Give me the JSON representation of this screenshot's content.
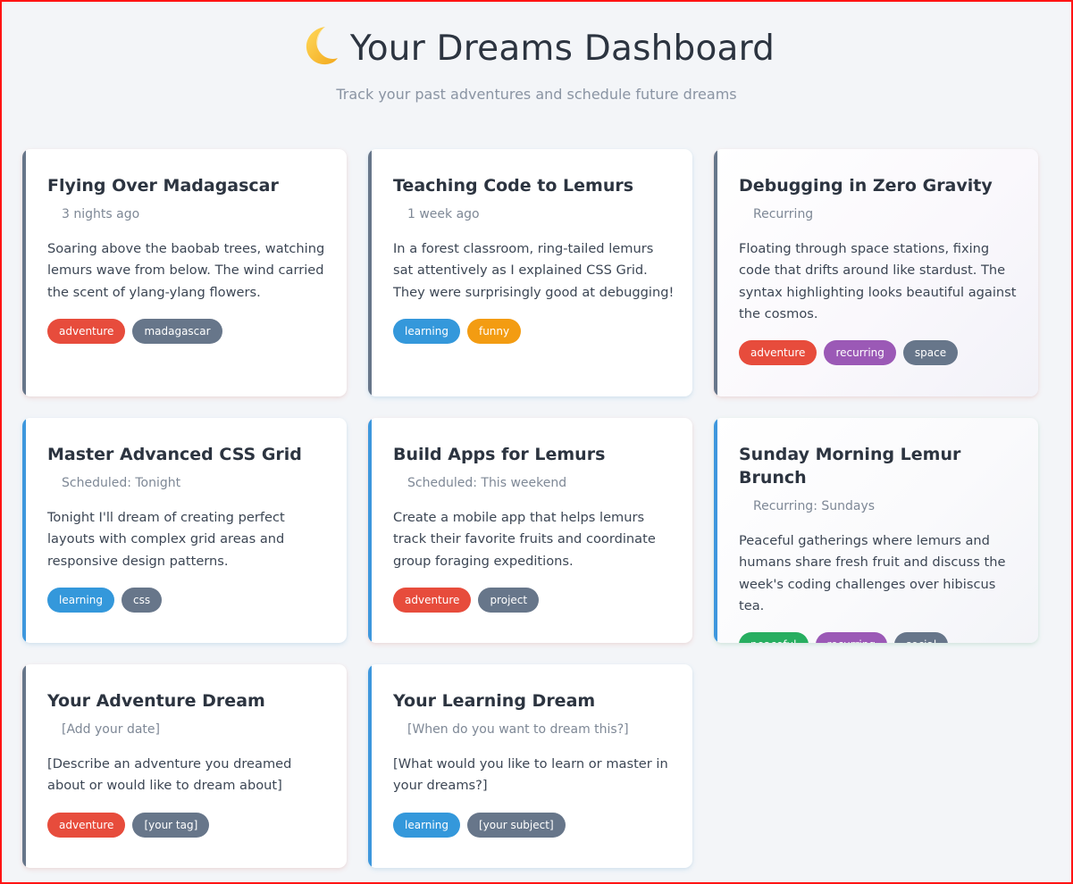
{
  "header": {
    "title": "Your Dreams Dashboard",
    "subtitle": "Track your past adventures and schedule future dreams",
    "moon_icon": "crescent-moon-icon"
  },
  "colors": {
    "page_bg": "#f3f5f8",
    "past_accent": "#67768a",
    "future_accent": "#3d97dd",
    "tag_adventure": "#e74c3c",
    "tag_learning": "#3498db",
    "tag_funny": "#f39c12",
    "tag_recurring": "#9b59b6",
    "tag_peaceful": "#27ae60",
    "tag_neutral": "#67768a"
  },
  "cards": [
    {
      "title": "Flying Over Madagascar",
      "date": "3 nights ago",
      "description": "Soaring above the baobab trees, watching lemurs wave from below. The wind carried the scent of ylang-ylang flowers.",
      "tags": [
        {
          "label": "adventure",
          "color": "#e74c3c"
        },
        {
          "label": "madagascar",
          "color": "#67768a"
        }
      ]
    },
    {
      "title": "Teaching Code to Lemurs",
      "date": "1 week ago",
      "description": "In a forest classroom, ring-tailed lemurs sat attentively as I explained CSS Grid. They were surprisingly good at debugging!",
      "tags": [
        {
          "label": "learning",
          "color": "#3498db"
        },
        {
          "label": "funny",
          "color": "#f39c12"
        }
      ]
    },
    {
      "title": "Debugging in Zero Gravity",
      "date": "Recurring",
      "description": "Floating through space stations, fixing code that drifts around like stardust. The syntax highlighting looks beautiful against the cosmos.",
      "tags": [
        {
          "label": "adventure",
          "color": "#e74c3c"
        },
        {
          "label": "recurring",
          "color": "#9b59b6"
        },
        {
          "label": "space",
          "color": "#67768a"
        }
      ]
    },
    {
      "title": "Master Advanced CSS Grid",
      "date": "Scheduled: Tonight",
      "description": "Tonight I'll dream of creating perfect layouts with complex grid areas and responsive design patterns.",
      "tags": [
        {
          "label": "learning",
          "color": "#3498db"
        },
        {
          "label": "css",
          "color": "#67768a"
        }
      ]
    },
    {
      "title": "Build Apps for Lemurs",
      "date": "Scheduled: This weekend",
      "description": "Create a mobile app that helps lemurs track their favorite fruits and coordinate group foraging expeditions.",
      "tags": [
        {
          "label": "adventure",
          "color": "#e74c3c"
        },
        {
          "label": "project",
          "color": "#67768a"
        }
      ]
    },
    {
      "title": "Sunday Morning Lemur Brunch",
      "date": "Recurring: Sundays",
      "description": "Peaceful gatherings where lemurs and humans share fresh fruit and discuss the week's coding challenges over hibiscus tea.",
      "tags": [
        {
          "label": "peaceful",
          "color": "#27ae60"
        },
        {
          "label": "recurring",
          "color": "#9b59b6"
        },
        {
          "label": "social",
          "color": "#67768a"
        }
      ]
    },
    {
      "title": "Your Adventure Dream",
      "date": "[Add your date]",
      "description": "[Describe an adventure you dreamed about or would like to dream about]",
      "tags": [
        {
          "label": "adventure",
          "color": "#e74c3c"
        },
        {
          "label": "[your tag]",
          "color": "#67768a"
        }
      ]
    },
    {
      "title": "Your Learning Dream",
      "date": "[When do you want to dream this?]",
      "description": "[What would you like to learn or master in your dreams?]",
      "tags": [
        {
          "label": "learning",
          "color": "#3498db"
        },
        {
          "label": "[your subject]",
          "color": "#67768a"
        }
      ]
    }
  ]
}
